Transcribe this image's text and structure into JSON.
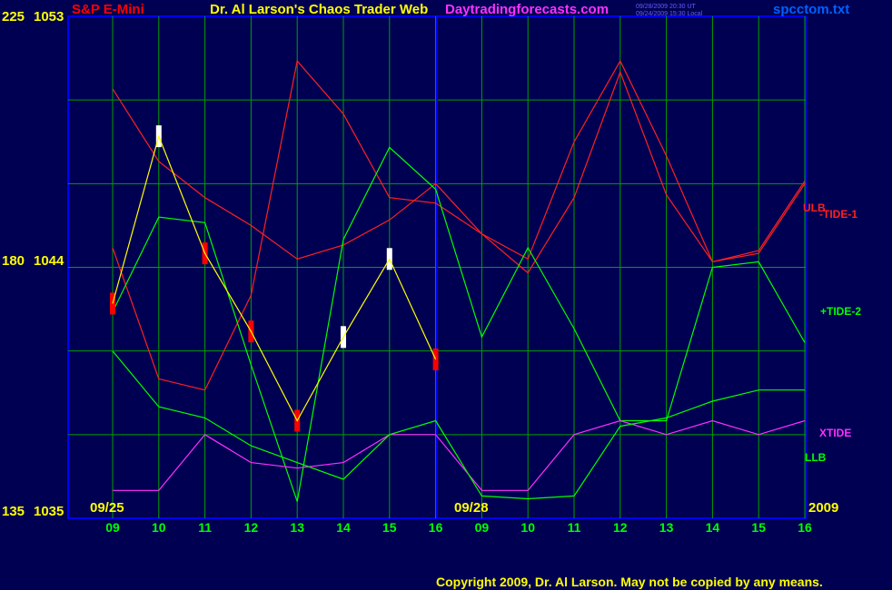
{
  "header": {
    "instrument": "S&P E-Mini",
    "title": "Dr. Al Larson's Chaos Trader Web",
    "site": "Daytradingforecasts.com",
    "stamp_ut": "09/28/2009 20:30 UT",
    "stamp_local": "09/24/2009 15:30 Local",
    "filename": "spcctom.txt"
  },
  "y_axis": {
    "labels": [
      {
        "left": "225",
        "right": "1053",
        "price": 1053
      },
      {
        "left": "180",
        "right": "1044",
        "price": 1044
      },
      {
        "left": "135",
        "right": "1035",
        "price": 1035
      }
    ]
  },
  "x_axis": {
    "ticks": [
      "09",
      "10",
      "11",
      "12",
      "13",
      "14",
      "15",
      "16",
      "09",
      "10",
      "11",
      "12",
      "13",
      "14",
      "15",
      "16"
    ],
    "date_labels": [
      "09/25",
      "09/28"
    ],
    "year": "2009"
  },
  "footer": {
    "copyright": "Copyright 2009, Dr. Al Larson. May not be copied by any means."
  },
  "colors": {
    "background": "#000052",
    "plot_border": "#0000ff",
    "grid": "#00a000",
    "axis_text": "#ffff00",
    "tick_text": "#00ff00",
    "price_bar": "#ff0000",
    "price_bar_up": "#ffffff",
    "ulb": "#ff2020",
    "tide1": "#ff2020",
    "tide2": "#00ff00",
    "xtide": "#ff30ff",
    "llb": "#00ff00",
    "avg_yellow": "#ffff00",
    "avg_blue": "#2020ff"
  },
  "chart_data": {
    "type": "line",
    "title": "S&P E-Mini",
    "x": [
      "09",
      "10",
      "11",
      "12",
      "13",
      "14",
      "15",
      "16",
      "09",
      "10",
      "11",
      "12",
      "13",
      "14",
      "15",
      "16"
    ],
    "ylim": [
      1035,
      1053
    ],
    "grid": true,
    "legend": "right",
    "series": [
      {
        "name": "ULB",
        "values": [
          1050.4,
          1047.8,
          1046.5,
          1045.5,
          1044.3,
          1044.8,
          1045.7,
          1047.0,
          1045.2,
          1043.8,
          1046.5,
          1051.0,
          1046.6,
          1044.2,
          1044.5,
          1047.0
        ]
      },
      {
        "name": "-TIDE-1",
        "values": [
          1044.7,
          1040.0,
          1039.6,
          1043.0,
          1051.4,
          1049.5,
          1046.5,
          1046.3,
          1045.2,
          1044.3,
          1048.5,
          1051.4,
          1048.0,
          1044.2,
          1044.6,
          1047.1
        ]
      },
      {
        "name": "+TIDE-2",
        "values": [
          1042.4,
          1045.8,
          1045.6,
          1040.5,
          1035.6,
          1045.0,
          1048.3,
          1046.8,
          1041.5,
          1044.7,
          1041.8,
          1038.5,
          1038.5,
          1044.0,
          1044.2,
          1041.3
        ]
      },
      {
        "name": "XTIDE",
        "values": [
          1036.0,
          1036.0,
          1038.0,
          1037.0,
          1036.8,
          1037.0,
          1038.0,
          1038.0,
          1036.0,
          1036.0,
          1038.0,
          1038.5,
          1038.0,
          1038.5,
          1038.0,
          1038.5
        ]
      },
      {
        "name": "LLB",
        "values": [
          1041.0,
          1039.0,
          1038.6,
          1037.6,
          1037.0,
          1036.4,
          1038.0,
          1038.5,
          1035.8,
          1035.7,
          1035.8,
          1038.3,
          1038.6,
          1039.2,
          1039.6,
          1039.6
        ]
      }
    ],
    "price_bars": {
      "x": [
        "09",
        "10",
        "11",
        "12",
        "13",
        "14",
        "15",
        "16"
      ],
      "values": [
        1042.7,
        1048.7,
        1044.5,
        1041.7,
        1038.5,
        1041.5,
        1044.3,
        1040.7
      ]
    }
  }
}
